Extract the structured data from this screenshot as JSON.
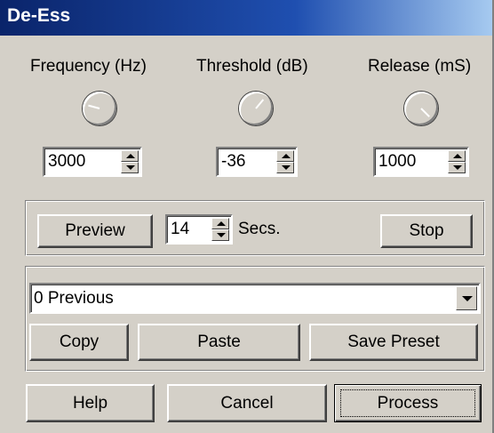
{
  "window": {
    "title": "De-Ess"
  },
  "params": {
    "frequency": {
      "label": "Frequency (Hz)",
      "value": "3000",
      "knob_angle_deg": 285
    },
    "threshold": {
      "label": "Threshold (dB)",
      "value": "-36",
      "knob_angle_deg": 40
    },
    "release": {
      "label": "Release (mS)",
      "value": "1000",
      "knob_angle_deg": 135
    }
  },
  "preview": {
    "preview_label": "Preview",
    "seconds_value": "14",
    "seconds_unit": "Secs.",
    "stop_label": "Stop"
  },
  "presets": {
    "selected": "0 Previous",
    "copy_label": "Copy",
    "paste_label": "Paste",
    "save_label": "Save Preset"
  },
  "footer": {
    "help_label": "Help",
    "cancel_label": "Cancel",
    "process_label": "Process"
  }
}
